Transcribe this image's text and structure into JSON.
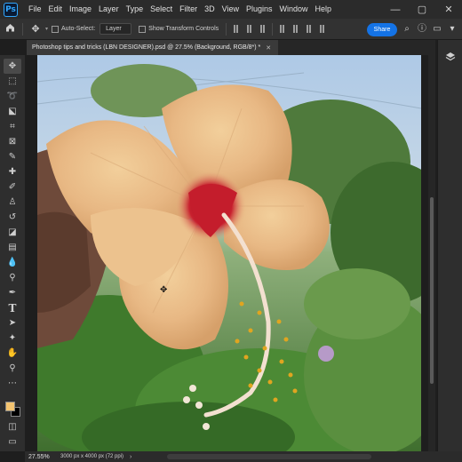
{
  "app": {
    "logo": "Ps"
  },
  "menu": [
    "File",
    "Edit",
    "Image",
    "Layer",
    "Type",
    "Select",
    "Filter",
    "3D",
    "View",
    "Plugins",
    "Window",
    "Help"
  ],
  "window_controls": {
    "minimize": "—",
    "restore": "▢",
    "close": "✕"
  },
  "options": {
    "home_icon": "home-icon",
    "move_icon": "move-icon",
    "auto_select_label": "Auto-Select:",
    "auto_select_target": "Layer",
    "show_transform_label": "Show Transform Controls",
    "share_label": "Share"
  },
  "document": {
    "tab_title": "Photoshop tips and tricks (LBN DESIGNER).psd @ 27.5% (Background, RGB/8*) *",
    "close_icon": "close-icon"
  },
  "tools": [
    "move-tool",
    "artboard-tool",
    "lasso-tool",
    "object-select-tool",
    "crop-tool",
    "frame-tool",
    "eyedropper-tool",
    "healing-brush-tool",
    "brush-tool",
    "clone-stamp-tool",
    "history-brush-tool",
    "eraser-tool",
    "gradient-tool",
    "blur-tool",
    "dodge-tool",
    "pen-tool",
    "type-tool",
    "path-select-tool",
    "rectangle-tool",
    "hand-tool",
    "zoom-tool",
    "more-tools"
  ],
  "colors": {
    "foreground": "#f4c470",
    "background": "#000000",
    "accent": "#1473e6"
  },
  "status": {
    "zoom": "27.55%",
    "doc_info": "3000 px x 4000 px (72 ppi)"
  }
}
